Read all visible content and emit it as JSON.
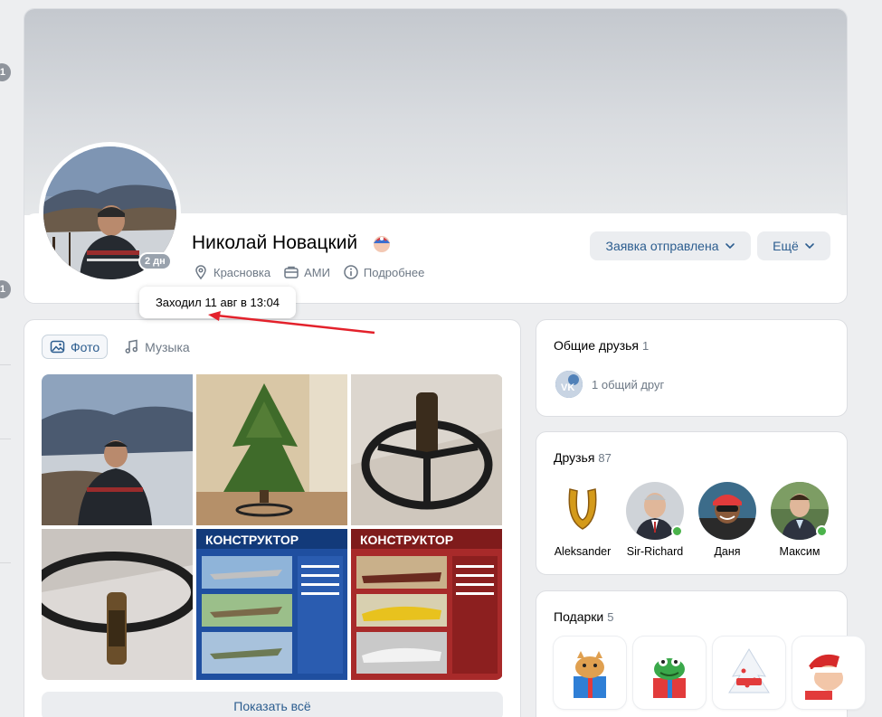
{
  "sidebar": {
    "badge_1": "1",
    "badge_2": "1"
  },
  "profile": {
    "name": "Николай Новацкий",
    "online_badge": "2 дн",
    "city": "Красновка",
    "work": "АМИ",
    "more_info": "Подробнее",
    "last_seen_tooltip": "Заходил 11 авг в 13:04",
    "request_button": "Заявка отправлена",
    "more_button": "Ещё"
  },
  "photos": {
    "tabs": [
      {
        "label": "Фото",
        "icon": "photo-icon",
        "active": true
      },
      {
        "label": "Музыка",
        "icon": "music-note-icon",
        "active": false
      }
    ],
    "show_all": "Показать всё"
  },
  "common_friends": {
    "title": "Общие друзья",
    "count": "1",
    "text": "1 общий друг"
  },
  "friends": {
    "title": "Друзья",
    "count": "87",
    "items": [
      {
        "name": "Aleksander",
        "online": false
      },
      {
        "name": "Sir-Richard",
        "online": true
      },
      {
        "name": "Даня",
        "online": false
      },
      {
        "name": "Максим",
        "online": true
      }
    ]
  },
  "gifts": {
    "title": "Подарки",
    "count": "5"
  },
  "colors": {
    "accent": "#2c5d8f",
    "button_bg": "#ebedf0",
    "page_bg": "#edeef0",
    "online": "#4bb34b",
    "arrow": "#e3212b"
  }
}
